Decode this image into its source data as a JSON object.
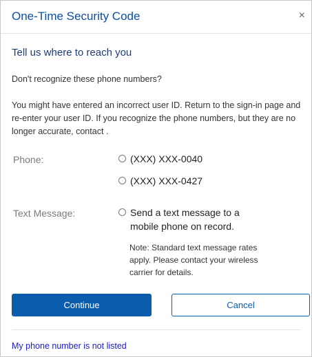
{
  "dialog": {
    "title": "One-Time Security Code",
    "close_glyph": "×",
    "close_icon": "close-icon"
  },
  "content": {
    "subheading": "Tell us where to reach you",
    "question": "Don't recognize these phone numbers?",
    "explanation": "You might have entered an incorrect user ID. Return to the sign-in page and re-enter your user ID. If you recognize the phone numbers, but they are no longer accurate, contact ."
  },
  "phone": {
    "label": "Phone:",
    "options": [
      {
        "label": "(XXX) XXX-0040",
        "selected": false
      },
      {
        "label": "(XXX) XXX-0427",
        "selected": false
      }
    ]
  },
  "text_message": {
    "label": "Text Message:",
    "option": {
      "label": "Send a text message to a mobile phone on record.",
      "selected": false
    },
    "note": "Note: Standard text message rates apply. Please contact your wireless carrier for details."
  },
  "actions": {
    "continue_label": "Continue",
    "cancel_label": "Cancel"
  },
  "footer": {
    "link_label": "My phone number is not listed"
  },
  "colors": {
    "title": "#0b4fa3",
    "primary_button": "#0b5cad",
    "link": "#1a1acc"
  }
}
